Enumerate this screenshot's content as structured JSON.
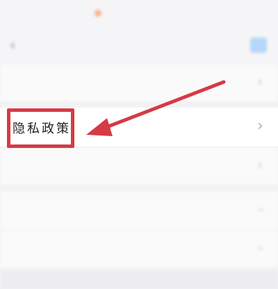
{
  "status_bar": {
    "left": "",
    "right": "",
    "accent_color": "#f5b38a"
  },
  "nav": {
    "title": "",
    "back_icon": "chevron-left-icon",
    "action_color": "#b6d7f7"
  },
  "rows": [
    {
      "label": ""
    },
    {
      "label": "隐私政策"
    },
    {
      "label": ""
    },
    {
      "label": ""
    },
    {
      "label": ""
    }
  ],
  "annotation": {
    "highlight_color": "#d63a45",
    "target": "隐私政策"
  }
}
